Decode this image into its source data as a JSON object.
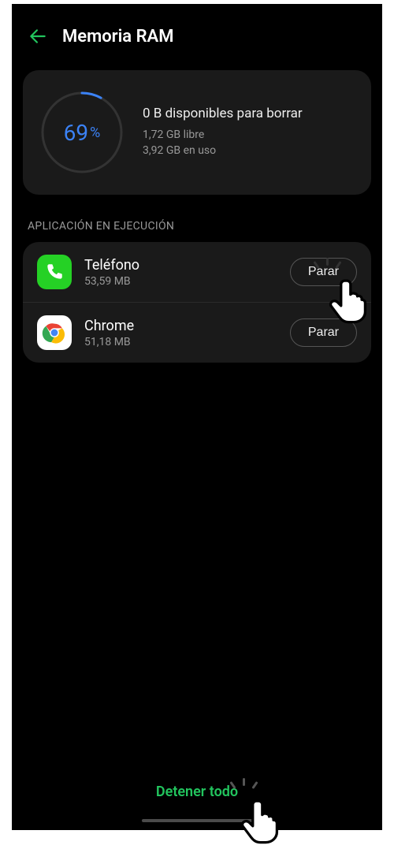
{
  "header": {
    "title": "Memoria RAM"
  },
  "ram": {
    "percent_value": "69",
    "percent_suffix": "%",
    "arc_fraction": 0.08,
    "available_title": "0 B disponibles para borrar",
    "free": "1,72 GB libre",
    "used": "3,92 GB en uso"
  },
  "section_header": "APLICACIÓN EN EJECUCIÓN",
  "apps": [
    {
      "name": "Teléfono",
      "size": "53,59 MB",
      "button": "Parar",
      "icon": "phone"
    },
    {
      "name": "Chrome",
      "size": "51,18 MB",
      "button": "Parar",
      "icon": "chrome"
    }
  ],
  "stop_all": "Detener todo"
}
